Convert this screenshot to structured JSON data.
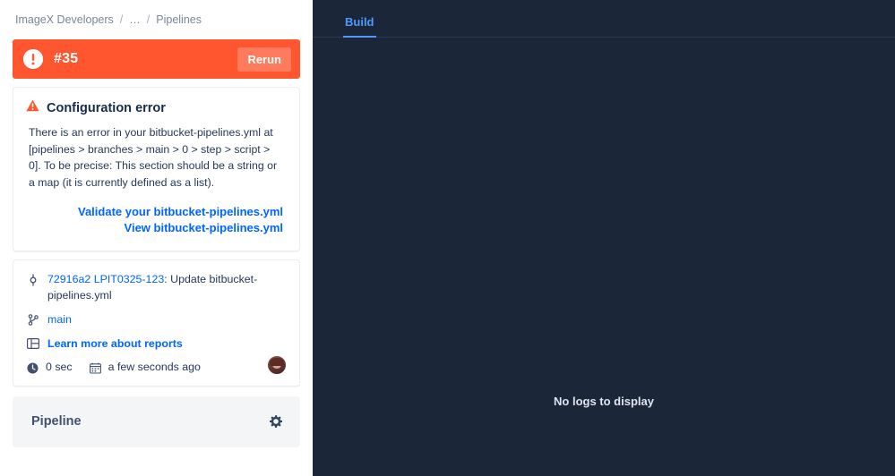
{
  "breadcrumb": {
    "items": [
      "ImageX Developers",
      "…",
      "Pipelines"
    ],
    "separator": "/"
  },
  "status_bar": {
    "icon": "error-circle-icon",
    "build_number": "#35",
    "rerun_label": "Rerun",
    "background_color": "#ff5630"
  },
  "error_card": {
    "icon": "warning-triangle-icon",
    "title": "Configuration error",
    "body": "There is an error in your bitbucket-pipelines.yml at [pipelines > branches > main > 0 > step > script > 0]. To be precise: This section should be a string or a map (it is currently defined as a list).",
    "links": [
      {
        "label": "Validate your bitbucket-pipelines.yml"
      },
      {
        "label": "View bitbucket-pipelines.yml"
      }
    ],
    "link_color": "#0065ff"
  },
  "commit_card": {
    "commit_icon": "commit-icon",
    "commit_hash": "72916a2",
    "commit_ticket": "LPIT0325-123",
    "commit_message": ": Update bitbucket-pipelines.yml",
    "branch_icon": "branch-icon",
    "branch_name": "main",
    "reports_icon": "reports-icon",
    "reports_label": "Learn more about reports",
    "duration_icon": "clock-icon",
    "duration": "0 sec",
    "date_icon": "calendar-icon",
    "date": "a few seconds ago",
    "avatar": "user-avatar"
  },
  "pipeline_card": {
    "title": "Pipeline",
    "settings_icon": "gear-icon"
  },
  "right_panel": {
    "tabs": [
      {
        "label": "Build",
        "active": true
      }
    ],
    "empty_state": "No logs to display",
    "background_color": "#1b2638",
    "accent_color": "#4c9aff"
  }
}
